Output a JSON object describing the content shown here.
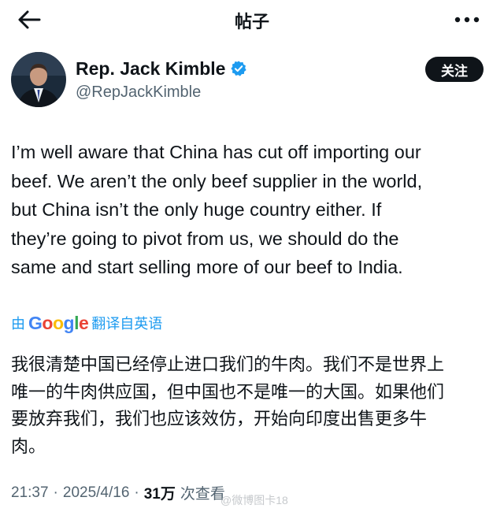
{
  "header": {
    "title": "帖子"
  },
  "user": {
    "display_name": "Rep. Jack Kimble",
    "handle": "@RepJackKimble",
    "follow_label": "关注"
  },
  "tweet": {
    "lines": [
      "I’m well aware that China has cut off importing our",
      "beef. We aren’t the only beef supplier in the world,",
      "but China isn’t the only huge country either. If",
      "they’re going to pivot from us, we should do the",
      "same and start selling more of our beef to India."
    ]
  },
  "translation": {
    "prefix": "由",
    "brand": "Google",
    "suffix": "翻译自英语",
    "lines": [
      "我很清楚中国已经停止进口我们的牛肉。我们不是世界上",
      "唯一的牛肉供应国，但中国也不是唯一的大国。如果他们",
      "要放弃我们，我们也应该效仿，开始向印度出售更多牛",
      "肉。"
    ]
  },
  "meta": {
    "time": "21:37",
    "date": "2025/4/16",
    "separator": "·",
    "views": "31万",
    "views_label": "次查看"
  },
  "watermark": "@微博图卡18",
  "colors": {
    "verified": "#1d9bf0",
    "link": "#1d9bf0",
    "secondary": "#536471",
    "button_bg": "#0f1419"
  }
}
